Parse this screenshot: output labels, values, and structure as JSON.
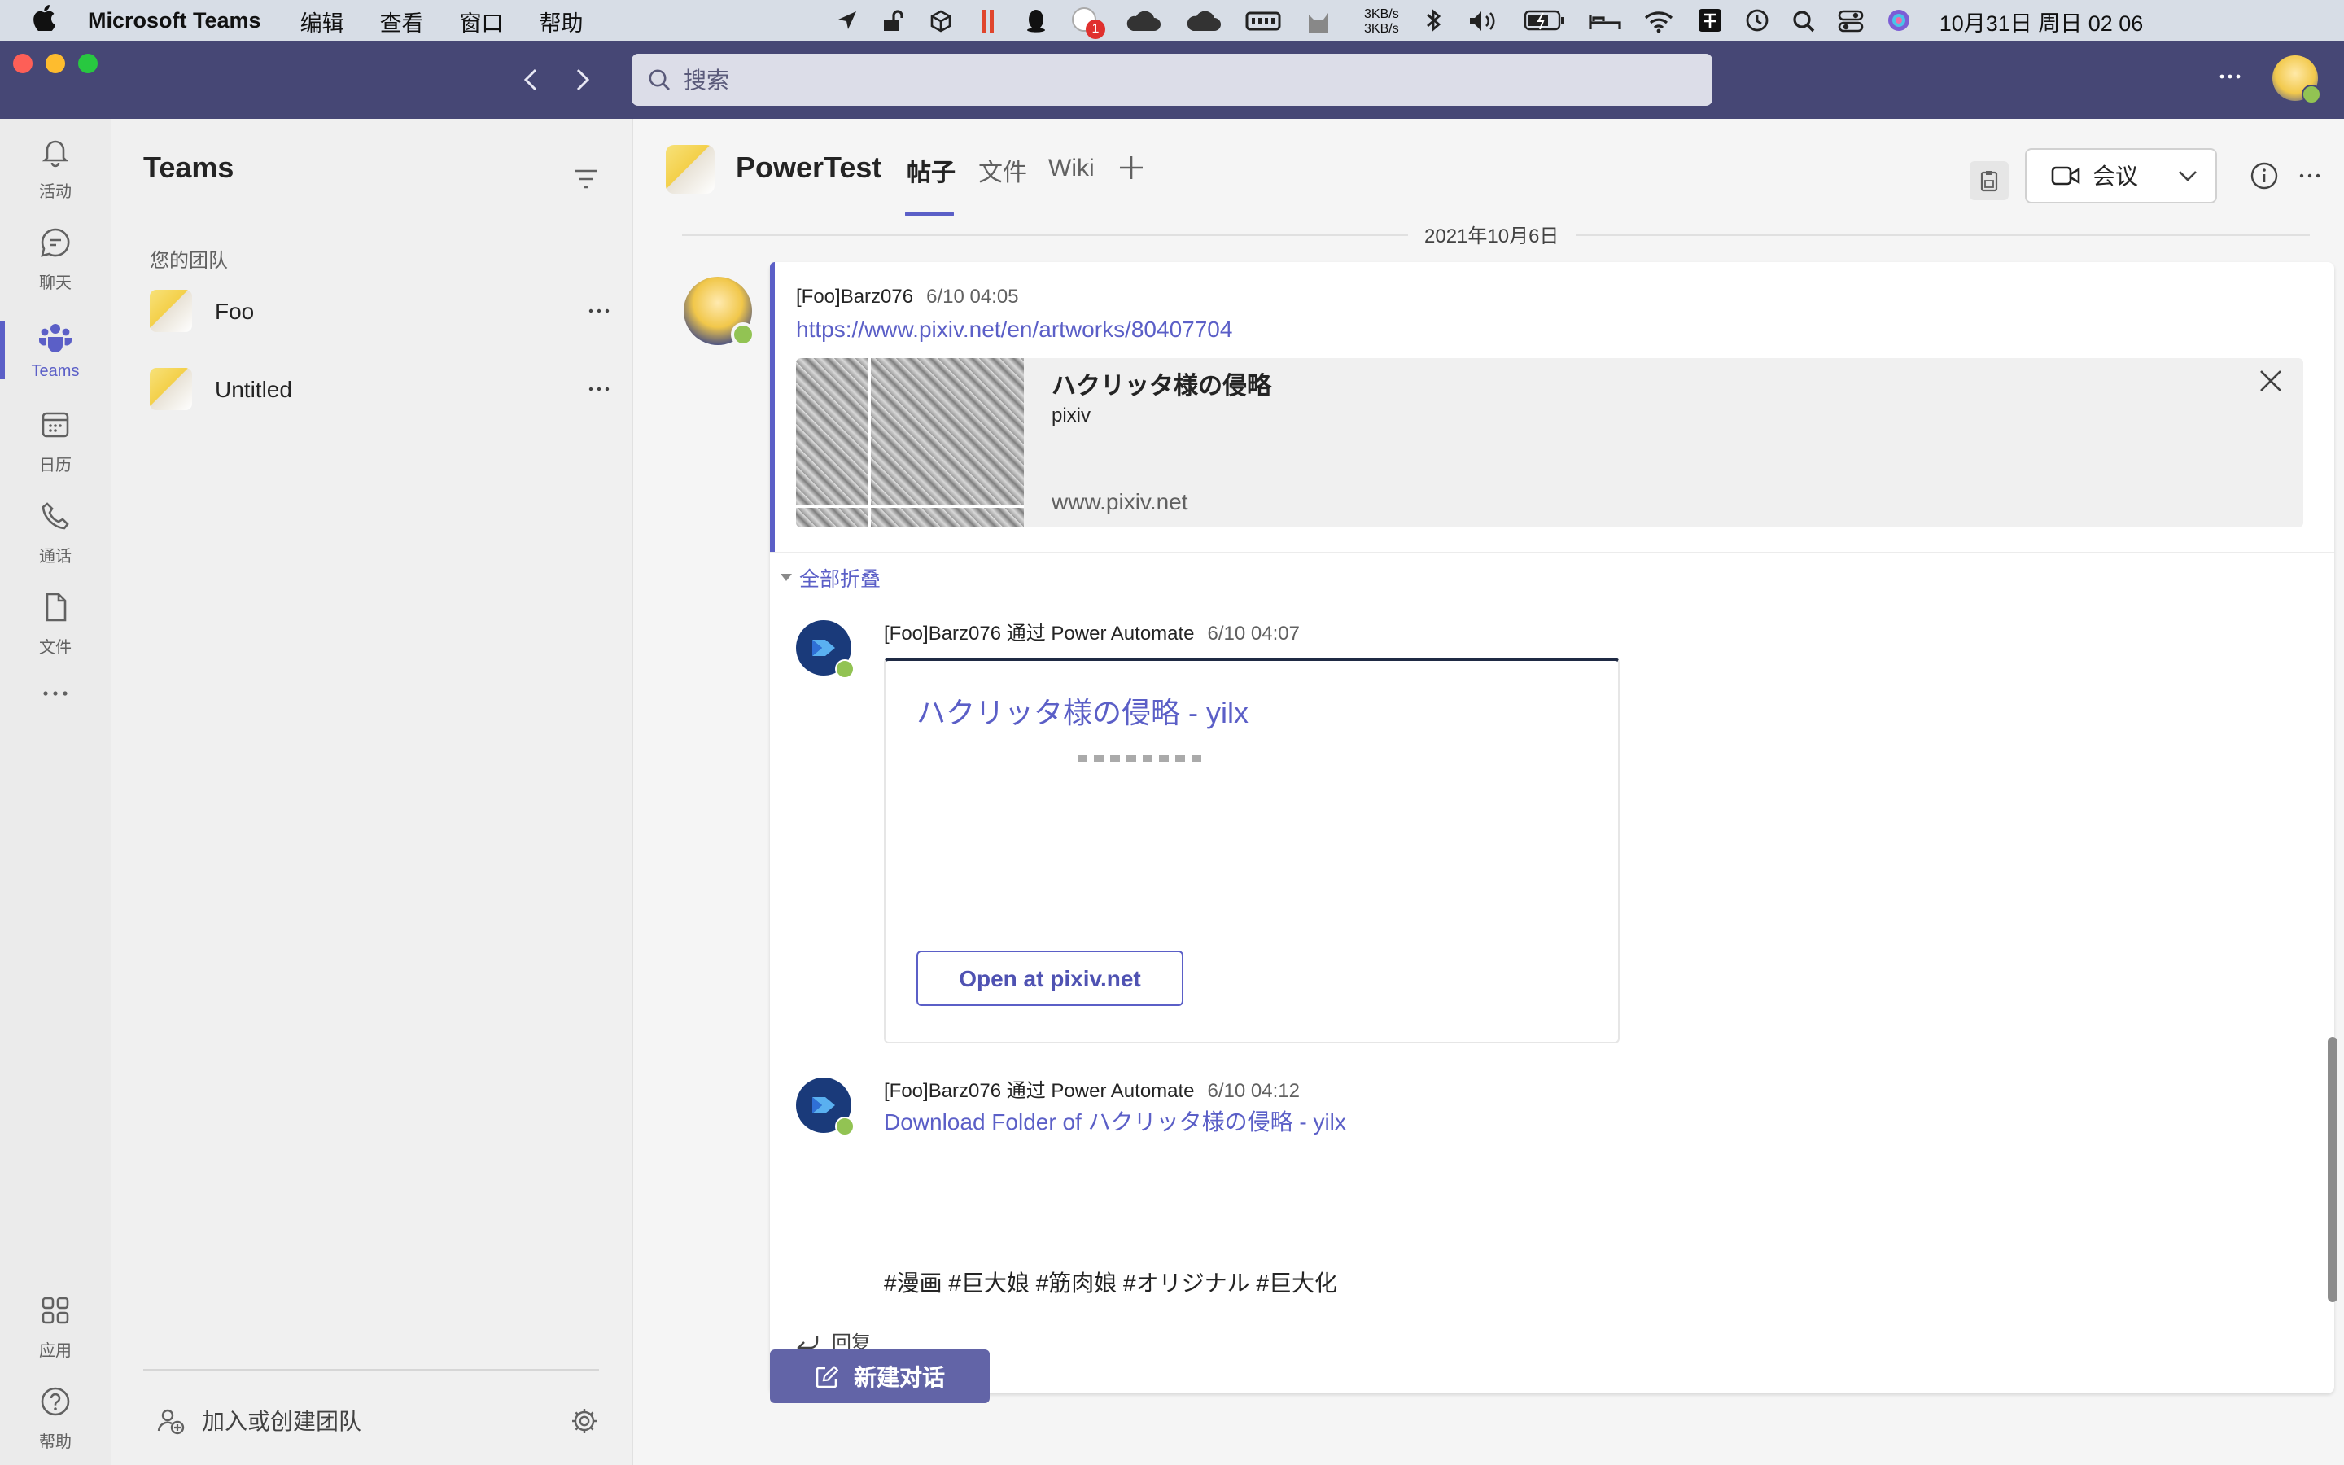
{
  "menubar": {
    "app_name": "Microsoft Teams",
    "items": [
      "编辑",
      "查看",
      "窗口",
      "帮助"
    ],
    "netspeed_up": "3KB/s",
    "netspeed_down": "3KB/s",
    "notification_badge": "1",
    "datetime": "10月31日 周日  02 06"
  },
  "titlebar": {
    "search_placeholder": "搜索"
  },
  "rail": {
    "items": [
      {
        "label": "活动",
        "icon": "bell-icon"
      },
      {
        "label": "聊天",
        "icon": "chat-icon"
      },
      {
        "label": "Teams",
        "icon": "teams-icon"
      },
      {
        "label": "日历",
        "icon": "calendar-icon"
      },
      {
        "label": "通话",
        "icon": "phone-icon"
      },
      {
        "label": "文件",
        "icon": "file-icon"
      }
    ],
    "more": "...",
    "apps_label": "应用",
    "help_label": "帮助"
  },
  "teams_pane": {
    "title": "Teams",
    "section_label": "您的团队",
    "teams": [
      {
        "name": "Foo"
      },
      {
        "name": "Untitled"
      }
    ],
    "more_glyph": "···",
    "join_label": "加入或创建团队"
  },
  "channel": {
    "name": "PowerTest",
    "tabs": [
      {
        "label": "帖子",
        "active": true
      },
      {
        "label": "文件",
        "active": false
      },
      {
        "label": "Wiki",
        "active": false
      }
    ],
    "add_tab_glyph": "+",
    "meeting_label": "会议"
  },
  "thread": {
    "date_divider": "2021年10月6日",
    "post": {
      "author": "[Foo]Barz076",
      "time": "6/10 04:05",
      "url": "https://www.pixiv.net/en/artworks/80407704",
      "preview": {
        "title": "ハクリッタ様の侵略",
        "site": "pixiv",
        "domain": "www.pixiv.net"
      }
    },
    "collapse_label": "全部折叠",
    "replies": [
      {
        "author": "[Foo]Barz076 通过 Power Automate",
        "time": "6/10 04:07",
        "card_title": "ハクリッタ様の侵略 - yilx",
        "card_button": "Open at pixiv.net"
      },
      {
        "author": "[Foo]Barz076 通过 Power Automate",
        "time": "6/10 04:12",
        "link_text": "Download Folder of ハクリッタ様の侵略 - yilx",
        "tags": "#漫画 #巨大娘 #筋肉娘 #オリジナル #巨大化"
      }
    ],
    "reply_label": "回复"
  },
  "new_conversation_label": "新建对话",
  "colors": {
    "brand": "#464775",
    "accent": "#5b5fc7",
    "online": "#92c353",
    "title_bar": "#464775"
  }
}
